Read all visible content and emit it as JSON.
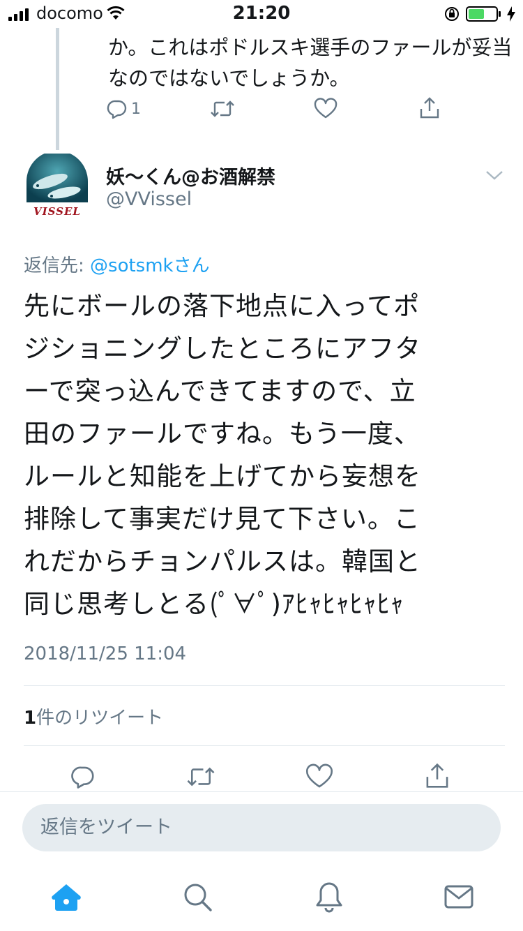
{
  "status_bar": {
    "carrier": "docomo",
    "time": "21:20"
  },
  "previous_tweet": {
    "text_lines": [
      "か。これはポドルスキ選手のファールが妥当",
      "なのではないでしょうか。"
    ],
    "reply_count": "1"
  },
  "tweet": {
    "display_name": "妖〜くん@お酒解禁",
    "handle": "@VVissel",
    "avatar_caption": "VISSEL",
    "reply_prefix": "返信先: ",
    "reply_mention": "@sotsmkさん",
    "body_lines": [
      "先にボールの落下地点に入ってポ",
      "ジショニングしたところにアフタ",
      "ーで突っ込んできてますので、立",
      "田のファールですね。もう一度、",
      "ルールと知能を上げてから妄想を",
      "排除して事実だけ見て下さい。こ",
      "れだからチョンパルスは。韓国と",
      "同じ思考しとる(ﾟ∀ﾟ)ｱﾋｬﾋｬﾋｬﾋｬ"
    ],
    "timestamp": "2018/11/25 11:04",
    "retweet_count": "1",
    "retweet_label": "件のリツイート"
  },
  "reply_input": {
    "placeholder": "返信をツイート"
  },
  "tab_bar": {
    "items": [
      "home-icon",
      "search-icon",
      "notifications-icon",
      "messages-icon"
    ],
    "active": "home-icon"
  },
  "colors": {
    "accent": "#1da1f2",
    "muted": "#657786",
    "divider": "#e1e8ed",
    "battery": "#4cd964"
  }
}
